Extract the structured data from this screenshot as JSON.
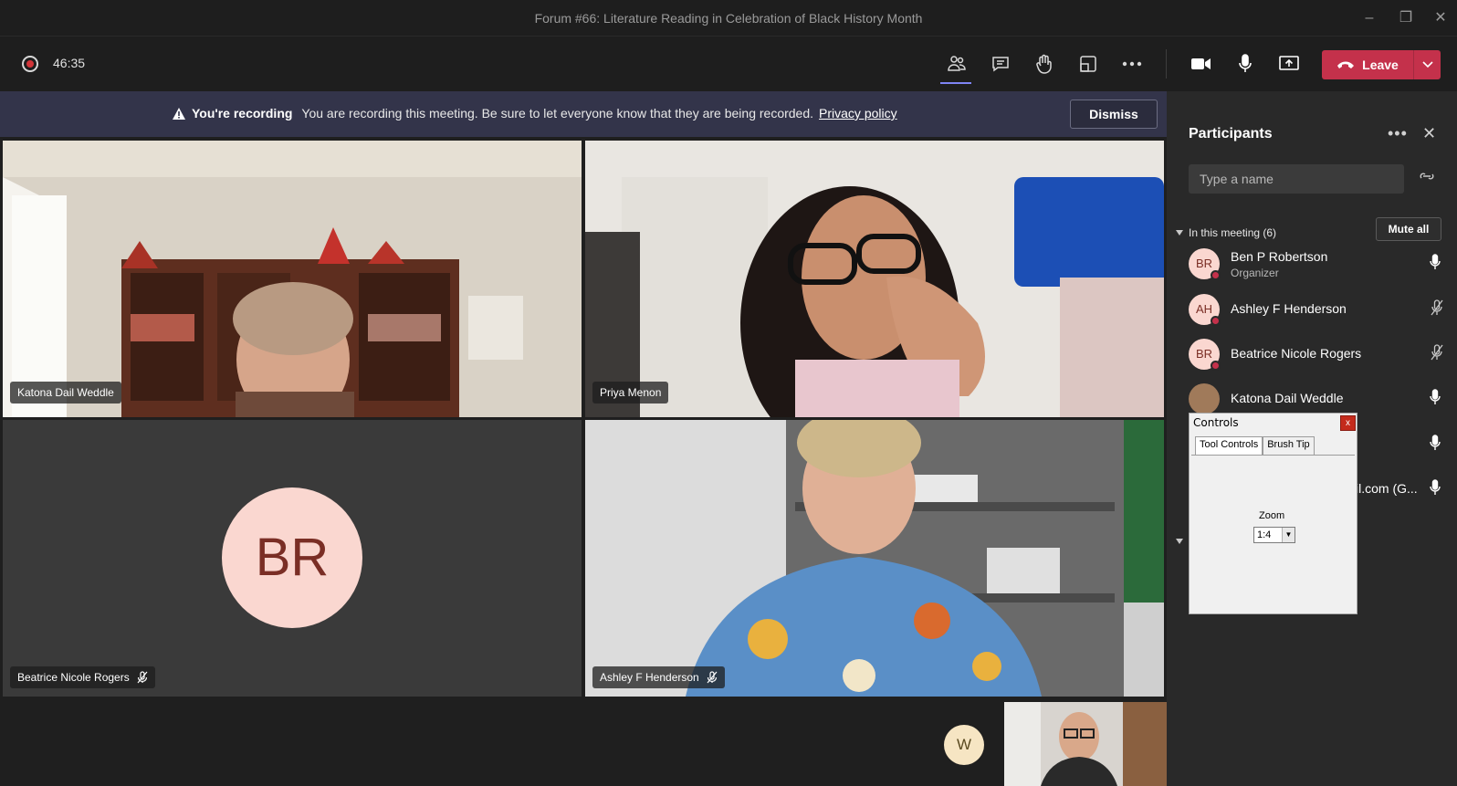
{
  "window": {
    "title": "Forum #66: Literature Reading in Celebration of Black History Month"
  },
  "toolbar": {
    "timer": "46:35",
    "leave_label": "Leave"
  },
  "banner": {
    "title": "You're recording",
    "message": "You are recording this meeting. Be sure to let everyone know that they are being recorded.",
    "link": "Privacy policy",
    "dismiss_label": "Dismiss"
  },
  "tiles": [
    {
      "name": "Katona Dail Weddle"
    },
    {
      "name": "Priya Menon"
    },
    {
      "name": "Beatrice Nicole Rogers",
      "initials": "BR"
    },
    {
      "name": "Ashley F Henderson"
    }
  ],
  "panel": {
    "title": "Participants",
    "search_placeholder": "Type a name",
    "section": "In this meeting (6)",
    "mute_all_label": "Mute all",
    "participants": [
      {
        "initials": "BR",
        "name": "Ben P Robertson",
        "role": "Organizer",
        "mic": "on"
      },
      {
        "initials": "AH",
        "name": "Ashley F Henderson",
        "mic": "off"
      },
      {
        "initials": "BR",
        "name": "Beatrice Nicole Rogers",
        "mic": "off"
      },
      {
        "initials": "",
        "name": "Katona Dail Weddle",
        "mic": "on"
      },
      {
        "initials": "",
        "name": "",
        "mic": "on"
      },
      {
        "initials": "",
        "name": "il.com (G...",
        "mic": "on"
      }
    ]
  },
  "controls_window": {
    "title": "Controls",
    "close": "x",
    "tabs": [
      "Tool Controls",
      "Brush Tip"
    ],
    "zoom_label": "Zoom",
    "zoom_value": "1:4"
  },
  "bottom": {
    "avatar_initial": "W"
  },
  "colors": {
    "leave": "#c4314b",
    "banner": "#33344a",
    "accent": "#7f85f5",
    "avatar_bg": "#fad7d0"
  }
}
